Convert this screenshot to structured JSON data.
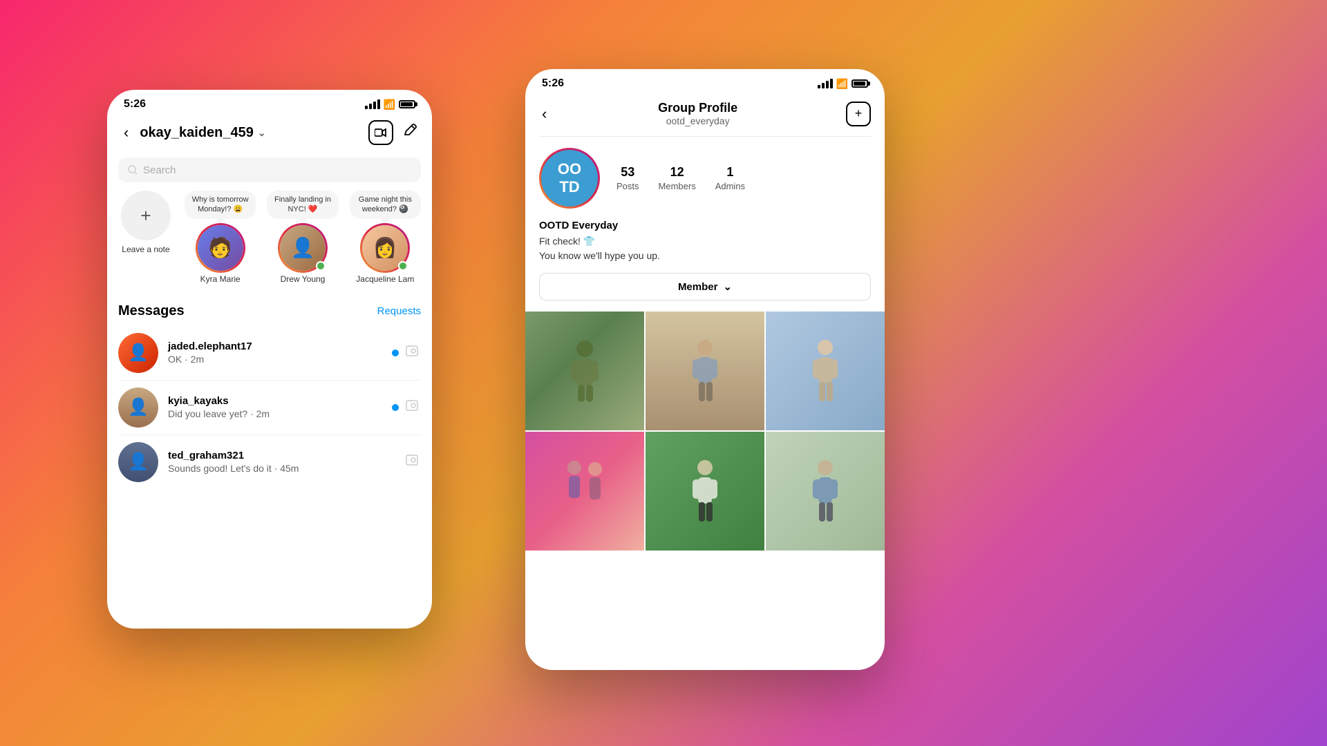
{
  "background": {
    "gradient": "linear-gradient(135deg, #f7276d 0%, #f5813a 30%, #e8a030 50%, #d44fa0 75%, #a044cc 100%)"
  },
  "left_phone": {
    "status_bar": {
      "time": "5:26"
    },
    "nav": {
      "back_label": "<",
      "title": "okay_kaiden_459",
      "chevron": "∨",
      "video_icon": "video",
      "edit_icon": "edit"
    },
    "search": {
      "placeholder": "Search"
    },
    "stories": [
      {
        "id": "self",
        "name": "Leave a note",
        "is_add": true
      },
      {
        "id": "kyra",
        "name": "Kyra Marie",
        "note": "Why is tomorrow Monday!? 😩",
        "online": false
      },
      {
        "id": "drew",
        "name": "Drew Young",
        "note": "Finally landing in NYC! ❤️",
        "online": true
      },
      {
        "id": "jacqueline",
        "name": "Jacqueline Lam",
        "note": "Game night this weekend? 🎱",
        "online": true
      }
    ],
    "messages": {
      "title": "Messages",
      "requests_label": "Requests",
      "items": [
        {
          "username": "jaded.elephant17",
          "preview": "OK · 2m",
          "unread": true,
          "has_camera": true
        },
        {
          "username": "kyia_kayaks",
          "preview": "Did you leave yet? · 2m",
          "unread": true,
          "has_camera": true
        },
        {
          "username": "ted_graham321",
          "preview": "Sounds good! Let's do it · 45m",
          "unread": false,
          "has_camera": true
        }
      ]
    }
  },
  "right_phone": {
    "status_bar": {
      "time": "5:26"
    },
    "nav": {
      "back_label": "<",
      "title": "Group Profile",
      "subtitle": "ootd_everyday",
      "plus_icon": "+"
    },
    "group": {
      "avatar_text": "OO\nTD",
      "stats": [
        {
          "number": "53",
          "label": "Posts"
        },
        {
          "number": "12",
          "label": "Members"
        },
        {
          "number": "1",
          "label": "Admins"
        }
      ],
      "name": "OOTD Everyday",
      "description": "Fit check! 👕\nYou know we'll hype you up.",
      "member_button": "Member ∨"
    },
    "photos": [
      {
        "id": "p1",
        "color_class": "photo-1"
      },
      {
        "id": "p2",
        "color_class": "photo-2"
      },
      {
        "id": "p3",
        "color_class": "photo-3"
      },
      {
        "id": "p4",
        "color_class": "photo-4"
      },
      {
        "id": "p5",
        "color_class": "photo-5"
      },
      {
        "id": "p6",
        "color_class": "photo-6"
      }
    ]
  }
}
